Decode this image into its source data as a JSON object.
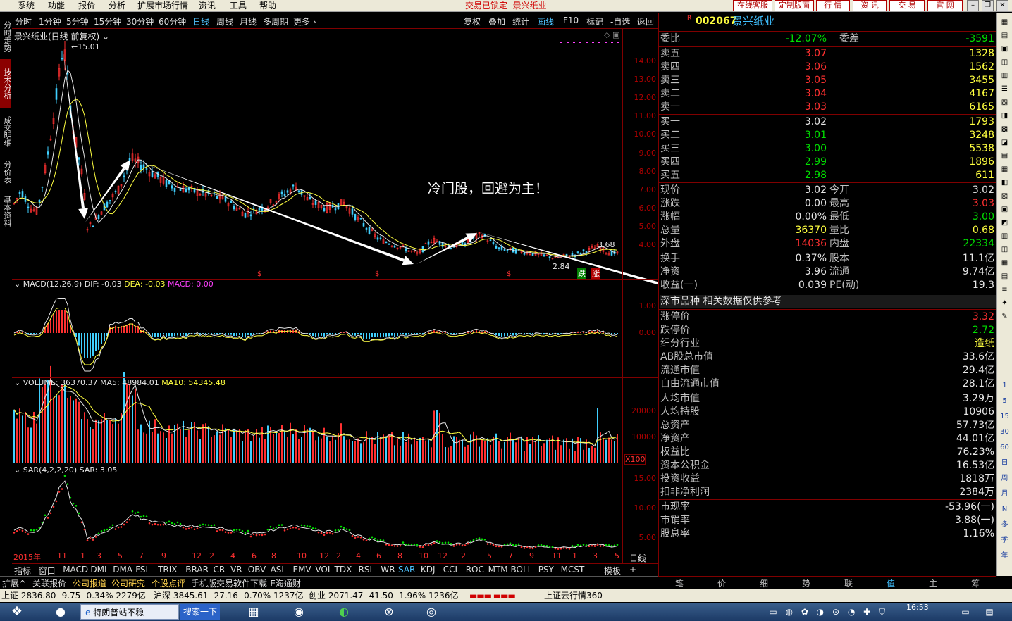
{
  "menu": {
    "items": [
      "系统",
      "功能",
      "报价",
      "分析",
      "扩展市场行情",
      "资讯",
      "工具",
      "帮助"
    ],
    "lock_status": "交易已锁定",
    "stock_title": "景兴纸业",
    "right_buttons": [
      "在线客服",
      "定制版面",
      "行 情",
      "资 讯",
      "交 易",
      "官 网"
    ]
  },
  "left_tabs": [
    "分时走势",
    "技术分析",
    "成交明细",
    "分价表",
    "基本资料"
  ],
  "period_bar": {
    "periods": [
      "分时",
      "1分钟",
      "5分钟",
      "15分钟",
      "30分钟",
      "60分钟",
      "日线",
      "周线",
      "月线",
      "多周期",
      "更多"
    ],
    "selected": "日线",
    "tools": [
      "复权",
      "叠加",
      "统计",
      "画线",
      "F10",
      "标记",
      "-自选",
      "返回"
    ]
  },
  "main_chart": {
    "title": "景兴纸业(日线 前复权)",
    "high_label": "15.01",
    "low_label": "2.84",
    "last_label": "3.68",
    "annotation": "冷门股，回避为主！",
    "yticks": [
      "14.00",
      "13.00",
      "12.00",
      "11.00",
      "10.00",
      "9.00",
      "8.00",
      "7.00",
      "6.00",
      "5.00",
      "4.00"
    ],
    "marks": [
      "跌",
      "涨"
    ]
  },
  "macd": {
    "label": "MACD(12,26,9)",
    "dif": "DIF: -0.03",
    "dea": "DEA: -0.03",
    "macd": "MACD: 0.00",
    "yticks": [
      "1.00",
      "0.00"
    ]
  },
  "volume": {
    "label": "VOLUME: 36370.37",
    "ma5": "MA5: 48984.01",
    "ma10": "MA10: 54345.48",
    "yticks": [
      "20000",
      "10000"
    ],
    "unit": "X100"
  },
  "sar": {
    "label": "SAR(4,2,2,20)",
    "value": "SAR: 3.05",
    "yticks": [
      "15.00",
      "10.00",
      "5.00"
    ]
  },
  "x_axis": {
    "labels": [
      "2015年",
      "11",
      "1",
      "3",
      "5",
      "7",
      "9",
      "12",
      "2",
      "4",
      "6",
      "8",
      "10",
      "12",
      "2",
      "4",
      "6",
      "8",
      "10",
      "12",
      "2",
      "5",
      "7",
      "9",
      "11",
      "1",
      "3",
      "5"
    ],
    "period": "日线"
  },
  "indicator_bar": {
    "items": [
      "指标",
      "窗口",
      "MACD",
      "DMI",
      "DMA",
      "FSL",
      "TRIX",
      "BRAR",
      "CR",
      "VR",
      "OBV",
      "ASI",
      "EMV",
      "VOL-TDX",
      "RSI",
      "WR",
      "SAR",
      "KDJ",
      "CCI",
      "ROC",
      "MTM",
      "BOLL",
      "PSY",
      "MCST"
    ],
    "selected": "SAR",
    "right": [
      "模板",
      "+",
      "-"
    ]
  },
  "info_tabs": [
    "扩展",
    "关联报价",
    "公司报道",
    "公司研究",
    "个股点评",
    "手机版交易软件下载-E海通财"
  ],
  "quote": {
    "code": "002067",
    "name": "景兴纸业",
    "weibi_label": "委比",
    "weibi": "-12.07%",
    "weicha_label": "委差",
    "weicha": "-3591",
    "asks": [
      {
        "label": "卖五",
        "price": "3.07",
        "vol": "1328"
      },
      {
        "label": "卖四",
        "price": "3.06",
        "vol": "1562"
      },
      {
        "label": "卖三",
        "price": "3.05",
        "vol": "3455"
      },
      {
        "label": "卖二",
        "price": "3.04",
        "vol": "4167"
      },
      {
        "label": "卖一",
        "price": "3.03",
        "vol": "6165"
      }
    ],
    "bids": [
      {
        "label": "买一",
        "price": "3.02",
        "vol": "1793"
      },
      {
        "label": "买二",
        "price": "3.01",
        "vol": "3248"
      },
      {
        "label": "买三",
        "price": "3.00",
        "vol": "5538"
      },
      {
        "label": "买四",
        "price": "2.99",
        "vol": "1896"
      },
      {
        "label": "买五",
        "price": "2.98",
        "vol": "611"
      }
    ],
    "stats": [
      {
        "k1": "现价",
        "v1": "3.02",
        "k2": "今开",
        "v2": "3.02"
      },
      {
        "k1": "涨跌",
        "v1": "0.00",
        "k2": "最高",
        "v2": "3.03"
      },
      {
        "k1": "涨幅",
        "v1": "0.00%",
        "k2": "最低",
        "v2": "3.00"
      },
      {
        "k1": "总量",
        "v1": "36370",
        "k2": "量比",
        "v2": "0.68"
      },
      {
        "k1": "外盘",
        "v1": "14036",
        "k2": "内盘",
        "v2": "22334"
      }
    ],
    "stats2": [
      {
        "k1": "换手",
        "v1": "0.37%",
        "k2": "股本",
        "v2": "11.1亿"
      },
      {
        "k1": "净资",
        "v1": "3.96",
        "k2": "流通",
        "v2": "9.74亿"
      },
      {
        "k1": "收益(一)",
        "v1": "0.039",
        "k2": "PE(动)",
        "v2": "19.3"
      }
    ],
    "market_note": "深市品种  相关数据仅供参考",
    "details": [
      {
        "k": "涨停价",
        "v": "3.32"
      },
      {
        "k": "跌停价",
        "v": "2.72"
      },
      {
        "k": "细分行业",
        "v": "造纸"
      },
      {
        "k": "AB股总市值",
        "v": "33.6亿"
      },
      {
        "k": "流通市值",
        "v": "29.4亿"
      },
      {
        "k": "自由流通市值",
        "v": "28.1亿"
      },
      {
        "k": "人均市值",
        "v": "3.29万"
      },
      {
        "k": "人均持股",
        "v": "10906"
      },
      {
        "k": "总资产",
        "v": "57.73亿"
      },
      {
        "k": "净资产",
        "v": "44.01亿"
      },
      {
        "k": "权益比",
        "v": "76.23%"
      },
      {
        "k": "资本公积金",
        "v": "16.53亿"
      },
      {
        "k": "投资收益",
        "v": "1818万"
      },
      {
        "k": "扣非净利润",
        "v": "2384万"
      },
      {
        "k": "市现率",
        "v": "-53.96(一)"
      },
      {
        "k": "市销率",
        "v": "3.88(一)"
      },
      {
        "k": "股息率",
        "v": "1.16%"
      }
    ]
  },
  "right_tabs": [
    "笔",
    "价",
    "细",
    "势",
    "联",
    "值",
    "主",
    "筹"
  ],
  "right_tab_selected": "值",
  "right_toolbar": [
    "1",
    "5",
    "15",
    "30",
    "60",
    "日",
    "周",
    "月",
    "N",
    "多",
    "季",
    "年"
  ],
  "index_bar": {
    "sh": "上证 2836.80  -9.75  -0.34% 2279亿",
    "hs": "沪深 3845.61  -27.16  -0.70% 1237亿",
    "cy": "创业 2071.47  -41.50  -1.96% 1236亿",
    "cloud": "上证云行情360"
  },
  "taskbar": {
    "item1": "特朗普站不稳",
    "item2": "搜索一下",
    "time": "16:53"
  }
}
